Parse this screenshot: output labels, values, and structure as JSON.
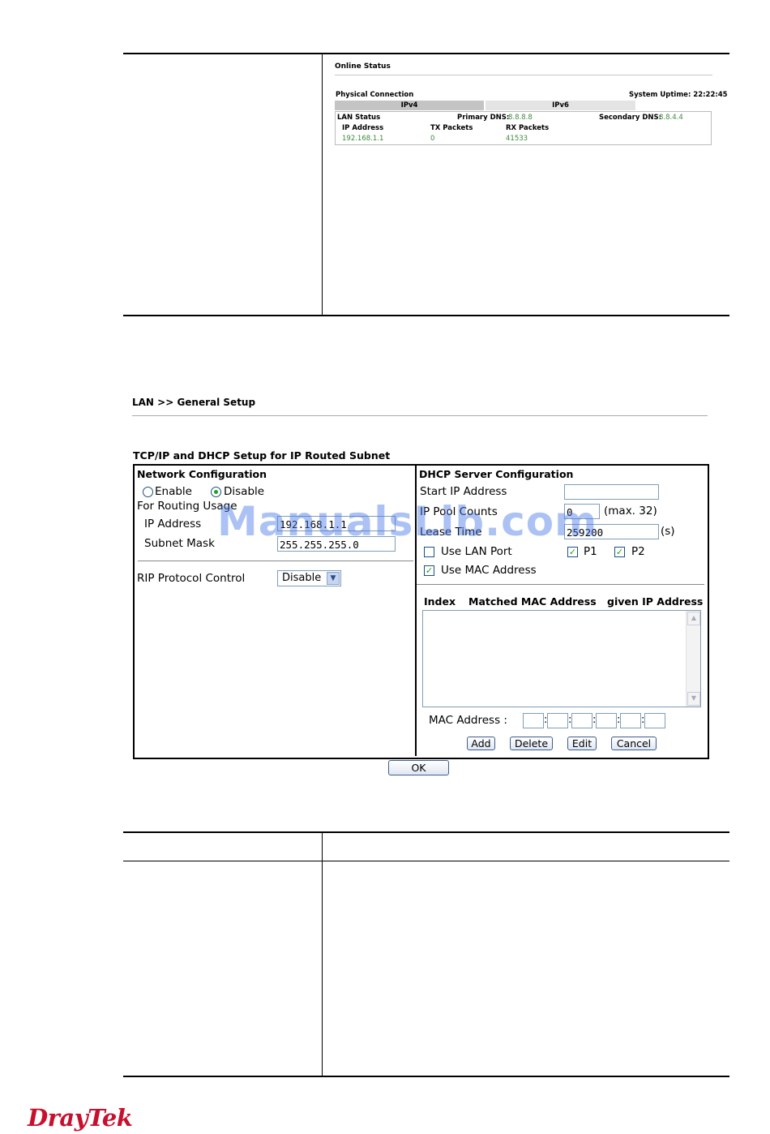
{
  "online_status": {
    "title": "Online Status",
    "physical_connection": "Physical Connection",
    "system_uptime": "System Uptime: 22:22:45",
    "tabs": [
      "IPv4",
      "IPv6"
    ],
    "lan_status": "LAN Status",
    "primary_dns_label": "Primary DNS:",
    "primary_dns_value": "8.8.8.8",
    "secondary_dns_label": "Secondary DNS:",
    "secondary_dns_value": "8.8.4.4",
    "columns": [
      "IP Address",
      "TX Packets",
      "RX Packets"
    ],
    "values": [
      "192.168.1.1",
      "0",
      "41533"
    ]
  },
  "lan_setup": {
    "breadcrumb": "LAN >> General Setup",
    "section_title": "TCP/IP and DHCP Setup for IP Routed Subnet",
    "network": {
      "title": "Network Configuration",
      "enable": "Enable",
      "disable": "Disable",
      "routing_usage": "For Routing Usage",
      "ip_label": "IP Address",
      "ip_value": "192.168.1.1",
      "mask_label": "Subnet Mask",
      "mask_value": "255.255.255.0",
      "rip_label": "RIP Protocol Control",
      "rip_value": "Disable"
    },
    "dhcp": {
      "title": "DHCP Server Configuration",
      "start_ip_label": "Start IP Address",
      "start_ip_value": "",
      "pool_label": "IP Pool Counts",
      "pool_value": "0",
      "pool_hint": "(max. 32)",
      "lease_label": "Lease Time",
      "lease_value": "259200",
      "lease_unit": "(s)",
      "use_lan_port": "Use LAN Port",
      "p1": "P1",
      "p2": "P2",
      "use_mac": "Use MAC Address",
      "col_index": "Index",
      "col_mac": "Matched MAC Address",
      "col_ip": "given IP Address",
      "mac_label": "MAC Address :",
      "add": "Add",
      "delete": "Delete",
      "edit": "Edit",
      "cancel": "Cancel"
    },
    "ok": "OK"
  },
  "watermark": "ManualsLib.com",
  "logo": "DrayTek",
  "colors": {
    "green": "#21a121",
    "logo_red": "#c8102e"
  }
}
